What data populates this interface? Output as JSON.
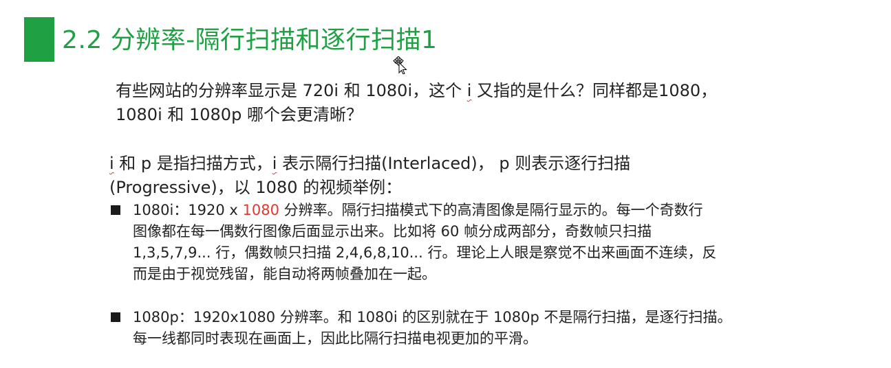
{
  "slide": {
    "title": "2.2 分辨率-隔行扫描和逐行扫描1",
    "question": {
      "line1_a": "有些网站的分辨率显示是 720i 和 1080i，这个 ",
      "line1_i": "i",
      "line1_b": " 又指的是什么？同样都是1080，",
      "line2": "1080i 和 1080p 哪个会更清晰？"
    },
    "answer": {
      "line1_i1": "i",
      "line1_a": " 和 p 是指扫描方式，",
      "line1_i2": "i",
      "line1_b": " 表示隔行扫描(Interlaced)， p 则表示逐行扫描",
      "line2": "(Progressive)，以 1080 的视频举例："
    },
    "bullets": [
      {
        "label": "1080i：1920 x ",
        "highlight": "1080",
        "line1_rest": " 分辨率。隔行扫描模式下的高清图像是隔行显示的。每一个奇数行",
        "line2": "图像都在每一偶数行图像后面显示出来。比如将 60 帧分成两部分，奇数帧只扫描",
        "line3": "1,3,5,7,9... 行，偶数帧只扫描 2,4,6,8,10... 行。理论上人眼是察觉不出来画面不连续，反",
        "line4": "而是由于视觉残留，能自动将两帧叠加在一起。"
      },
      {
        "line1": "1080p：1920x1080 分辨率。和 1080i 的区别就在于 1080p 不是隔行扫描，是逐行扫描。",
        "line2": "每一线都同时表现在画面上，因此比隔行扫描电视更加的平滑。"
      }
    ]
  },
  "colors": {
    "accent": "#1fa043",
    "highlight": "#e03a2e",
    "text": "#222222"
  },
  "icons": {
    "cursor": "move-cursor-icon",
    "bullet": "square-bullet-icon"
  }
}
